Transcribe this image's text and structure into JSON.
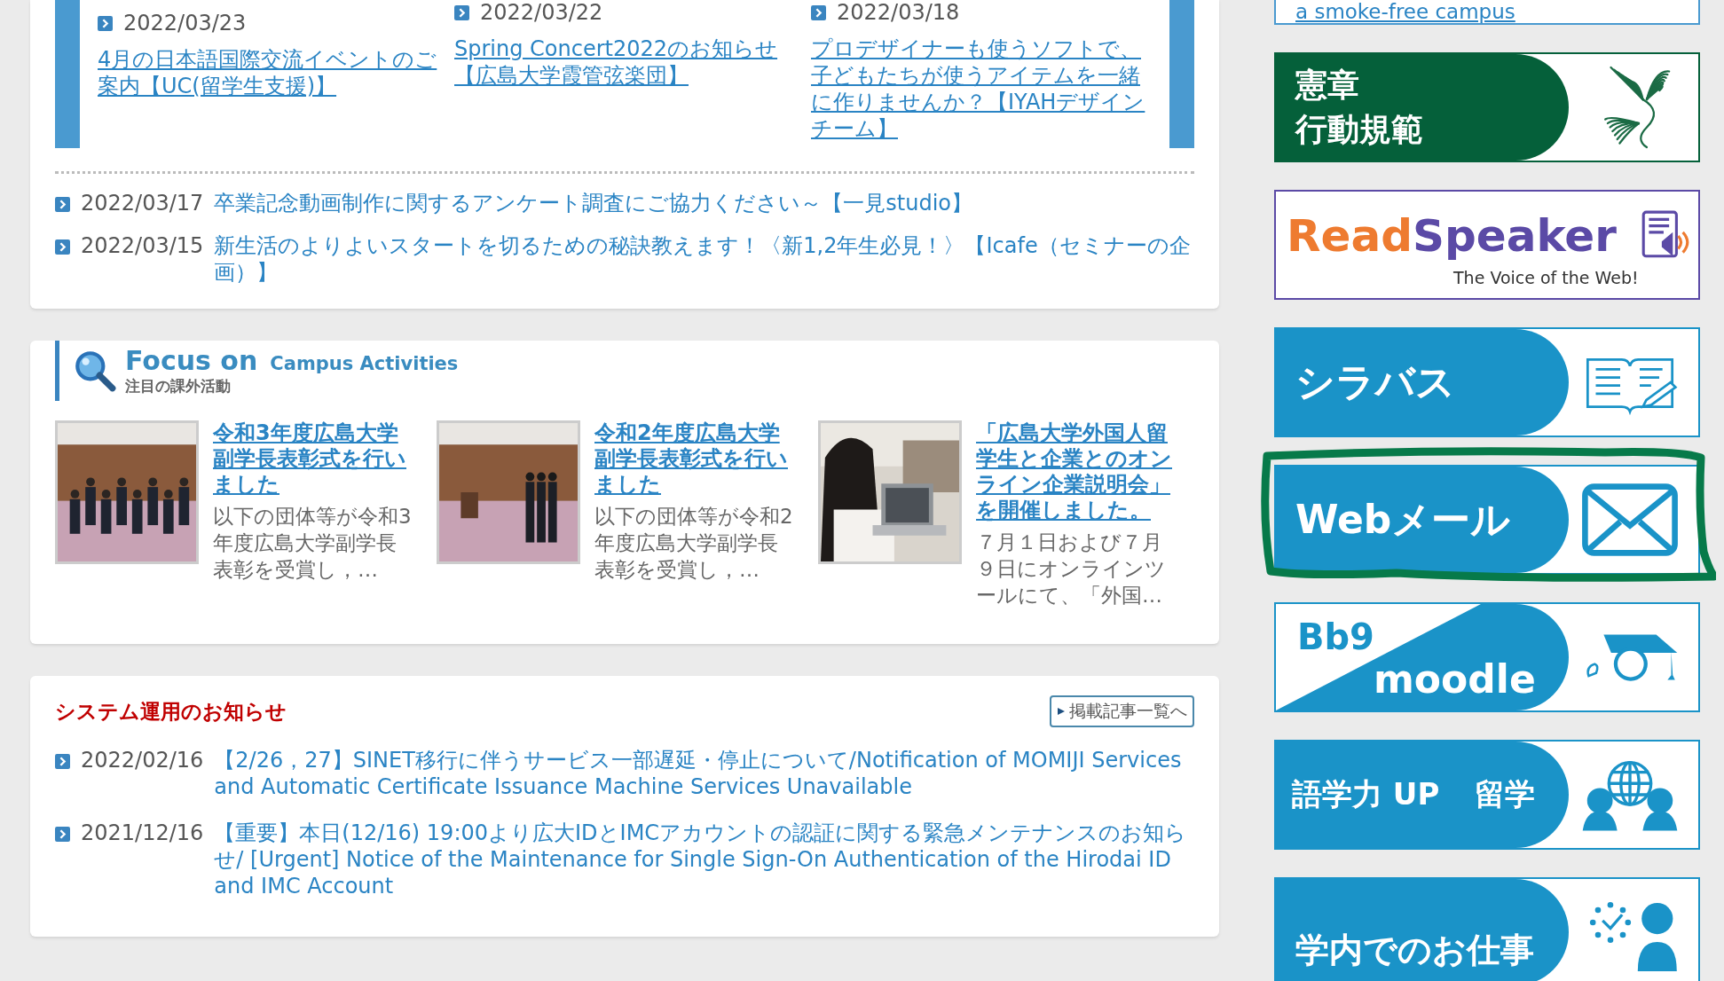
{
  "pickup": [
    {
      "date": "2022/03/23",
      "title": "4月の日本語国際交流イベントのご案内【UC(留学生支援)】"
    },
    {
      "date": "2022/03/22",
      "title": "Spring Concert2022のお知らせ【広島大学霞管弦楽団】"
    },
    {
      "date": "2022/03/18",
      "title": "プロデザイナーも使うソフトで、子どもたちが使うアイテムを一緒に作りませんか？【IYAHデザインチーム】"
    }
  ],
  "news": [
    {
      "date": "2022/03/17",
      "title": "卒業記念動画制作に関するアンケート調査にご協力ください～【一見studio】"
    },
    {
      "date": "2022/03/15",
      "title": "新生活のよりよいスタートを切るための秘訣教えます！〈新1,2年生必見！〉【Icafe（セミナーの企画）】"
    }
  ],
  "focus": {
    "title": "Focus on",
    "subtitle": "Campus Activities",
    "caption": "注目の課外活動",
    "items": [
      {
        "title": "令和3年度広島大学副学長表彰式を行いました",
        "excerpt": "以下の団体等が令和3年度広島大学副学長表彰を受賞し，…",
        "kind": "picture"
      },
      {
        "title": "令和2年度広島大学副学長表彰式を行いました",
        "excerpt": "以下の団体等が令和2年度広島大学副学長表彰を受賞し，…",
        "kind": "picture"
      },
      {
        "title": "「広島大学外国人留学生と企業とのオンライン企業説明会」を開催しました。",
        "excerpt": "７月１日および７月９日にオンラインツールにて、「外国…",
        "kind": "picture"
      }
    ]
  },
  "system_notices": {
    "title": "システム運用のお知らせ",
    "more_link": "掲載記事一覧へ",
    "items": [
      {
        "date": "2022/02/16",
        "title": "【2/26，27】SINET移行に伴うサービス一部遅延・停止について/Notification of MOMIJI Services and Automatic Certificate Issuance Machine Services Unavailable"
      },
      {
        "date": "2021/12/16",
        "title": "【重要】本日(12/16) 19:00より広大IDとIMCアカウントの認証に関する緊急メンテナンスのお知らせ/ [Urgent] Notice of the Maintenance for Single Sign-On Authentication of the Hirodai ID and IMC Account"
      }
    ]
  },
  "sidebar": {
    "smoke_free_link": "a smoke-free campus",
    "banners": [
      {
        "kind": "charter",
        "lines": [
          "憲章",
          "行動規範"
        ],
        "highlighted": false
      },
      {
        "kind": "readspeaker",
        "lines": [
          "Read",
          "Speaker",
          "The Voice of the Web!"
        ],
        "highlighted": false
      },
      {
        "kind": "syllabus",
        "lines": [
          "シラバス"
        ],
        "highlighted": false
      },
      {
        "kind": "webmail",
        "lines": [
          "Webメール"
        ],
        "highlighted": true
      },
      {
        "kind": "moodle",
        "lines": [
          "Bb9",
          "moodle"
        ],
        "highlighted": false
      },
      {
        "kind": "language",
        "lines": [
          "語学力 UP",
          "留学"
        ],
        "highlighted": false
      },
      {
        "kind": "work",
        "lines": [
          "学内でのお仕事"
        ],
        "highlighted": false
      }
    ]
  }
}
